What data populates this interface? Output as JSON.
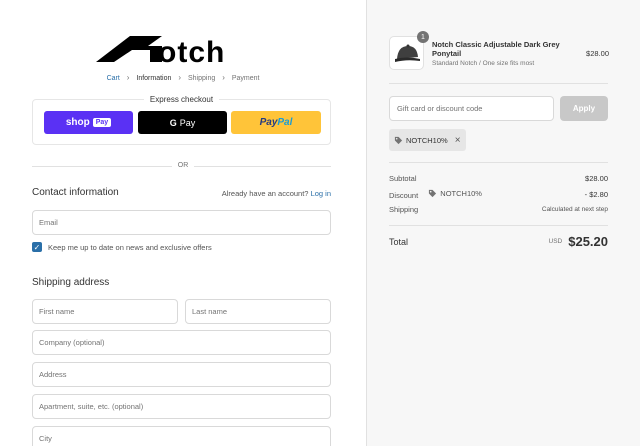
{
  "brand": {
    "name": "Notch"
  },
  "breadcrumb": [
    {
      "label": "Cart",
      "state": "link"
    },
    {
      "label": "Information",
      "state": "current"
    },
    {
      "label": "Shipping",
      "state": "upcoming"
    },
    {
      "label": "Payment",
      "state": "upcoming"
    }
  ],
  "express": {
    "title": "Express checkout",
    "shoppay_label": "shop",
    "shoppay_pill": "Pay",
    "gpay_g": "G",
    "gpay_label": "Pay",
    "paypal_a": "Pay",
    "paypal_b": "Pal"
  },
  "divider_label": "OR",
  "contact": {
    "title": "Contact information",
    "account_prompt": "Already have an account?",
    "login_label": "Log in",
    "email_placeholder": "Email",
    "newsletter_label": "Keep me up to date on news and exclusive offers",
    "newsletter_checked": true
  },
  "shipping": {
    "title": "Shipping address",
    "first_name_placeholder": "First name",
    "last_name_placeholder": "Last name",
    "company_placeholder": "Company (optional)",
    "address_placeholder": "Address",
    "apartment_placeholder": "Apartment, suite, etc. (optional)",
    "city_placeholder": "City"
  },
  "cart": {
    "item": {
      "quantity": "1",
      "name": "Notch Classic Adjustable Dark Grey Ponytail",
      "variant": "Standard Notch / One size fits most",
      "price": "$28.00"
    },
    "discount_placeholder": "Gift card or discount code",
    "apply_label": "Apply",
    "applied_code": "NOTCH10%",
    "subtotal_label": "Subtotal",
    "subtotal_value": "$28.00",
    "discount_label": "Discount",
    "discount_code": "NOTCH10%",
    "discount_value": "- $2.80",
    "shipping_label": "Shipping",
    "shipping_value": "Calculated at next step",
    "total_label": "Total",
    "currency": "USD",
    "total_value": "$25.20"
  },
  "colors": {
    "accent": "#2a6fa8",
    "shoppay": "#5a31f4",
    "paypal": "#ffc439",
    "sidebar_bg": "#f7f7f7"
  }
}
